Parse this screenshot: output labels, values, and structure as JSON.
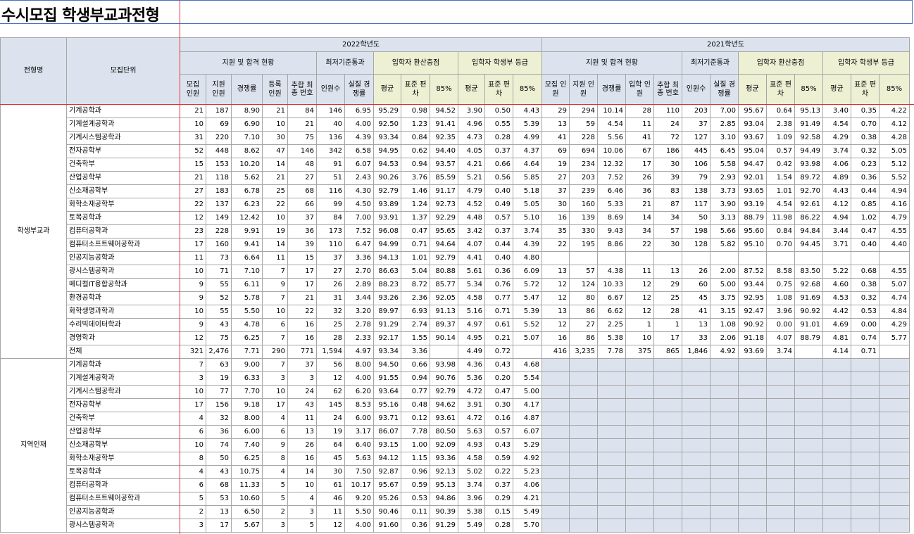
{
  "title": "수시모집 학생부교과전형",
  "header": {
    "col_type": "전형명",
    "col_unit": "모집단위",
    "year_2022": "2022학년도",
    "year_2021": "2021학년도",
    "apply": "지원 및 합격 현황",
    "minimum": "최저기준통과",
    "conv_score": "입학자 환산충점",
    "record_grade": "입학자 학생부 등급",
    "sub": [
      "모집 인원",
      "지원 인원",
      "경쟁률",
      "등록 인원",
      "추합 최종 번호",
      "인원수",
      "실질 경쟁률",
      "평균",
      "표준 편차",
      "85%",
      "평균",
      "표준 편차",
      "85%"
    ],
    "sub2021": [
      "모집 인원",
      "지원 인원",
      "경쟁률",
      "입학 인원",
      "추합 최종 번호",
      "인원수",
      "실질 경쟁률",
      "평균",
      "표준 편차",
      "85%",
      "평균",
      "표준 편차",
      "85%"
    ]
  },
  "groups": [
    {
      "name": "학생부교과",
      "rows": [
        {
          "unit": "기계공학과",
          "a": [
            "21",
            "187",
            "8.90",
            "21",
            "84",
            "146",
            "6.95",
            "95.29",
            "0.98",
            "94.52",
            "3.90",
            "0.50",
            "4.43"
          ],
          "b": [
            "29",
            "294",
            "10.14",
            "28",
            "110",
            "203",
            "7.00",
            "95.67",
            "0.64",
            "95.13",
            "3.40",
            "0.35",
            "4.22"
          ]
        },
        {
          "unit": "기계설계공학과",
          "a": [
            "10",
            "69",
            "6.90",
            "10",
            "21",
            "40",
            "4.00",
            "92.50",
            "1.23",
            "91.41",
            "4.96",
            "0.55",
            "5.39"
          ],
          "b": [
            "13",
            "59",
            "4.54",
            "11",
            "24",
            "37",
            "2.85",
            "93.04",
            "2.38",
            "91.49",
            "4.54",
            "0.70",
            "4.12"
          ]
        },
        {
          "unit": "기계시스템공학과",
          "a": [
            "31",
            "220",
            "7.10",
            "30",
            "75",
            "136",
            "4.39",
            "93.34",
            "0.84",
            "92.35",
            "4.73",
            "0.28",
            "4.99"
          ],
          "b": [
            "41",
            "228",
            "5.56",
            "41",
            "72",
            "127",
            "3.10",
            "93.67",
            "1.09",
            "92.58",
            "4.29",
            "0.38",
            "4.28"
          ]
        },
        {
          "unit": "전자공학부",
          "a": [
            "52",
            "448",
            "8.62",
            "47",
            "146",
            "342",
            "6.58",
            "94.95",
            "0.62",
            "94.40",
            "4.05",
            "0.37",
            "4.37"
          ],
          "b": [
            "69",
            "694",
            "10.06",
            "67",
            "186",
            "445",
            "6.45",
            "95.04",
            "0.57",
            "94.49",
            "3.74",
            "0.32",
            "5.05"
          ]
        },
        {
          "unit": "건축학부",
          "a": [
            "15",
            "153",
            "10.20",
            "14",
            "48",
            "91",
            "6.07",
            "94.53",
            "0.94",
            "93.57",
            "4.21",
            "0.66",
            "4.64"
          ],
          "b": [
            "19",
            "234",
            "12.32",
            "17",
            "30",
            "106",
            "5.58",
            "94.47",
            "0.42",
            "93.98",
            "4.06",
            "0.23",
            "5.12"
          ]
        },
        {
          "unit": "산업공학부",
          "a": [
            "21",
            "118",
            "5.62",
            "21",
            "27",
            "51",
            "2.43",
            "90.26",
            "3.76",
            "85.59",
            "5.21",
            "0.56",
            "5.85"
          ],
          "b": [
            "27",
            "203",
            "7.52",
            "26",
            "39",
            "79",
            "2.93",
            "92.01",
            "1.54",
            "89.72",
            "4.89",
            "0.36",
            "5.52"
          ]
        },
        {
          "unit": "신소재공학부",
          "a": [
            "27",
            "183",
            "6.78",
            "25",
            "68",
            "116",
            "4.30",
            "92.79",
            "1.46",
            "91.17",
            "4.79",
            "0.40",
            "5.18"
          ],
          "b": [
            "37",
            "239",
            "6.46",
            "36",
            "83",
            "138",
            "3.73",
            "93.65",
            "1.01",
            "92.70",
            "4.43",
            "0.44",
            "4.94"
          ]
        },
        {
          "unit": "화학소재공학부",
          "a": [
            "22",
            "137",
            "6.23",
            "22",
            "66",
            "99",
            "4.50",
            "93.89",
            "1.24",
            "92.73",
            "4.52",
            "0.49",
            "5.05"
          ],
          "b": [
            "30",
            "160",
            "5.33",
            "21",
            "87",
            "117",
            "3.90",
            "93.19",
            "4.54",
            "92.61",
            "4.12",
            "0.85",
            "4.16"
          ]
        },
        {
          "unit": "토목공학과",
          "a": [
            "12",
            "149",
            "12.42",
            "10",
            "37",
            "84",
            "7.00",
            "93.91",
            "1.37",
            "92.29",
            "4.48",
            "0.57",
            "5.10"
          ],
          "b": [
            "16",
            "139",
            "8.69",
            "14",
            "34",
            "50",
            "3.13",
            "88.79",
            "11.98",
            "86.22",
            "4.94",
            "1.02",
            "4.79"
          ]
        },
        {
          "unit": "컴퓨터공학과",
          "a": [
            "23",
            "228",
            "9.91",
            "19",
            "36",
            "173",
            "7.52",
            "96.08",
            "0.47",
            "95.65",
            "3.42",
            "0.37",
            "3.74"
          ],
          "b": [
            "35",
            "330",
            "9.43",
            "34",
            "57",
            "198",
            "5.66",
            "95.60",
            "0.84",
            "94.84",
            "3.44",
            "0.47",
            "4.55"
          ]
        },
        {
          "unit": "컴퓨터소프트웨어공학과",
          "a": [
            "17",
            "160",
            "9.41",
            "14",
            "39",
            "110",
            "6.47",
            "94.99",
            "0.71",
            "94.64",
            "4.07",
            "0.44",
            "4.39"
          ],
          "b": [
            "22",
            "195",
            "8.86",
            "22",
            "30",
            "128",
            "5.82",
            "95.10",
            "0.70",
            "94.45",
            "3.71",
            "0.40",
            "4.40"
          ]
        },
        {
          "unit": "인공지능공학과",
          "a": [
            "11",
            "73",
            "6.64",
            "11",
            "15",
            "37",
            "3.36",
            "94.13",
            "1.01",
            "92.79",
            "4.41",
            "0.40",
            "4.80"
          ],
          "b": [
            "",
            "",
            "",
            "",
            "",
            "",
            "",
            "",
            "",
            "",
            "",
            "",
            ""
          ]
        },
        {
          "unit": "광시스템공학과",
          "a": [
            "10",
            "71",
            "7.10",
            "7",
            "17",
            "27",
            "2.70",
            "86.63",
            "5.04",
            "80.88",
            "5.61",
            "0.36",
            "6.09"
          ],
          "b": [
            "13",
            "57",
            "4.38",
            "11",
            "13",
            "26",
            "2.00",
            "87.52",
            "8.58",
            "83.50",
            "5.22",
            "0.68",
            "4.55"
          ]
        },
        {
          "unit": "메디컬IT융합공학과",
          "a": [
            "9",
            "55",
            "6.11",
            "9",
            "17",
            "26",
            "2.89",
            "88.23",
            "8.72",
            "85.77",
            "5.34",
            "0.76",
            "5.72"
          ],
          "b": [
            "12",
            "124",
            "10.33",
            "12",
            "29",
            "60",
            "5.00",
            "93.44",
            "0.75",
            "92.68",
            "4.60",
            "0.38",
            "5.07"
          ]
        },
        {
          "unit": "환경공학과",
          "a": [
            "9",
            "52",
            "5.78",
            "7",
            "21",
            "31",
            "3.44",
            "93.26",
            "2.36",
            "92.05",
            "4.58",
            "0.77",
            "5.47"
          ],
          "b": [
            "12",
            "80",
            "6.67",
            "12",
            "25",
            "45",
            "3.75",
            "92.95",
            "1.08",
            "91.69",
            "4.53",
            "0.32",
            "4.74"
          ]
        },
        {
          "unit": "화학생명과학과",
          "a": [
            "10",
            "55",
            "5.50",
            "10",
            "22",
            "32",
            "3.20",
            "89.97",
            "6.93",
            "91.13",
            "5.16",
            "0.71",
            "5.39"
          ],
          "b": [
            "13",
            "86",
            "6.62",
            "12",
            "28",
            "41",
            "3.15",
            "92.47",
            "3.96",
            "90.92",
            "4.42",
            "0.53",
            "4.84"
          ]
        },
        {
          "unit": "수리빅데이터학과",
          "a": [
            "9",
            "43",
            "4.78",
            "6",
            "16",
            "25",
            "2.78",
            "91.29",
            "2.74",
            "89.37",
            "4.97",
            "0.61",
            "5.52"
          ],
          "b": [
            "12",
            "27",
            "2.25",
            "1",
            "1",
            "13",
            "1.08",
            "90.92",
            "0.00",
            "91.01",
            "4.69",
            "0.00",
            "4.29"
          ]
        },
        {
          "unit": "경영학과",
          "a": [
            "12",
            "75",
            "6.25",
            "7",
            "16",
            "28",
            "2.33",
            "92.17",
            "1.55",
            "90.14",
            "4.95",
            "0.21",
            "5.07"
          ],
          "b": [
            "16",
            "86",
            "5.38",
            "10",
            "17",
            "33",
            "2.06",
            "91.18",
            "4.07",
            "88.79",
            "4.81",
            "0.74",
            "5.77"
          ]
        },
        {
          "unit": "전체",
          "a": [
            "321",
            "2,476",
            "7.71",
            "290",
            "771",
            "1,594",
            "4.97",
            "93.34",
            "3.36",
            "",
            "4.49",
            "0.72",
            ""
          ],
          "b": [
            "416",
            "3,235",
            "7.78",
            "375",
            "865",
            "1,846",
            "4.92",
            "93.69",
            "3.74",
            "",
            "4.14",
            "0.71",
            ""
          ]
        }
      ]
    },
    {
      "name": "지역인재",
      "rows": [
        {
          "unit": "기계공학과",
          "a": [
            "7",
            "63",
            "9.00",
            "7",
            "37",
            "56",
            "8.00",
            "94.50",
            "0.66",
            "93.98",
            "4.36",
            "0.43",
            "4.68"
          ]
        },
        {
          "unit": "기계설계공학과",
          "a": [
            "3",
            "19",
            "6.33",
            "3",
            "3",
            "12",
            "4.00",
            "91.55",
            "0.94",
            "90.76",
            "5.36",
            "0.20",
            "5.54"
          ]
        },
        {
          "unit": "기계시스템공학과",
          "a": [
            "10",
            "77",
            "7.70",
            "10",
            "24",
            "62",
            "6.20",
            "93.64",
            "0.77",
            "92.79",
            "4.72",
            "0.47",
            "5.00"
          ]
        },
        {
          "unit": "전자공학부",
          "a": [
            "17",
            "156",
            "9.18",
            "17",
            "43",
            "145",
            "8.53",
            "95.16",
            "0.48",
            "94.62",
            "3.91",
            "0.30",
            "4.17"
          ]
        },
        {
          "unit": "건축학부",
          "a": [
            "4",
            "32",
            "8.00",
            "4",
            "11",
            "24",
            "6.00",
            "93.71",
            "0.12",
            "93.61",
            "4.72",
            "0.16",
            "4.87"
          ]
        },
        {
          "unit": "산업공학부",
          "a": [
            "6",
            "36",
            "6.00",
            "6",
            "13",
            "19",
            "3.17",
            "86.07",
            "7.78",
            "80.50",
            "5.63",
            "0.57",
            "6.07"
          ]
        },
        {
          "unit": "신소재공학부",
          "a": [
            "10",
            "74",
            "7.40",
            "9",
            "26",
            "64",
            "6.40",
            "93.15",
            "1.00",
            "92.09",
            "4.93",
            "0.43",
            "5.29"
          ]
        },
        {
          "unit": "화학소재공학부",
          "a": [
            "8",
            "50",
            "6.25",
            "8",
            "16",
            "45",
            "5.63",
            "94.12",
            "1.15",
            "93.36",
            "4.58",
            "0.59",
            "4.92"
          ]
        },
        {
          "unit": "토목공학과",
          "a": [
            "4",
            "43",
            "10.75",
            "4",
            "14",
            "30",
            "7.50",
            "92.87",
            "0.96",
            "92.13",
            "5.02",
            "0.22",
            "5.23"
          ]
        },
        {
          "unit": "컴퓨터공학과",
          "a": [
            "6",
            "68",
            "11.33",
            "5",
            "10",
            "61",
            "10.17",
            "95.67",
            "0.59",
            "95.13",
            "3.74",
            "0.37",
            "4.06"
          ]
        },
        {
          "unit": "컴퓨터소프트웨어공학과",
          "a": [
            "5",
            "53",
            "10.60",
            "5",
            "4",
            "46",
            "9.20",
            "95.26",
            "0.53",
            "94.86",
            "3.96",
            "0.29",
            "4.21"
          ]
        },
        {
          "unit": "인공지능공학과",
          "a": [
            "2",
            "13",
            "6.50",
            "2",
            "3",
            "11",
            "5.50",
            "90.46",
            "0.11",
            "90.39",
            "5.38",
            "0.15",
            "5.49"
          ]
        },
        {
          "unit": "광시스템공학과",
          "a": [
            "3",
            "17",
            "5.67",
            "3",
            "5",
            "12",
            "4.00",
            "91.60",
            "0.36",
            "91.29",
            "5.49",
            "0.28",
            "5.70"
          ]
        }
      ]
    }
  ]
}
